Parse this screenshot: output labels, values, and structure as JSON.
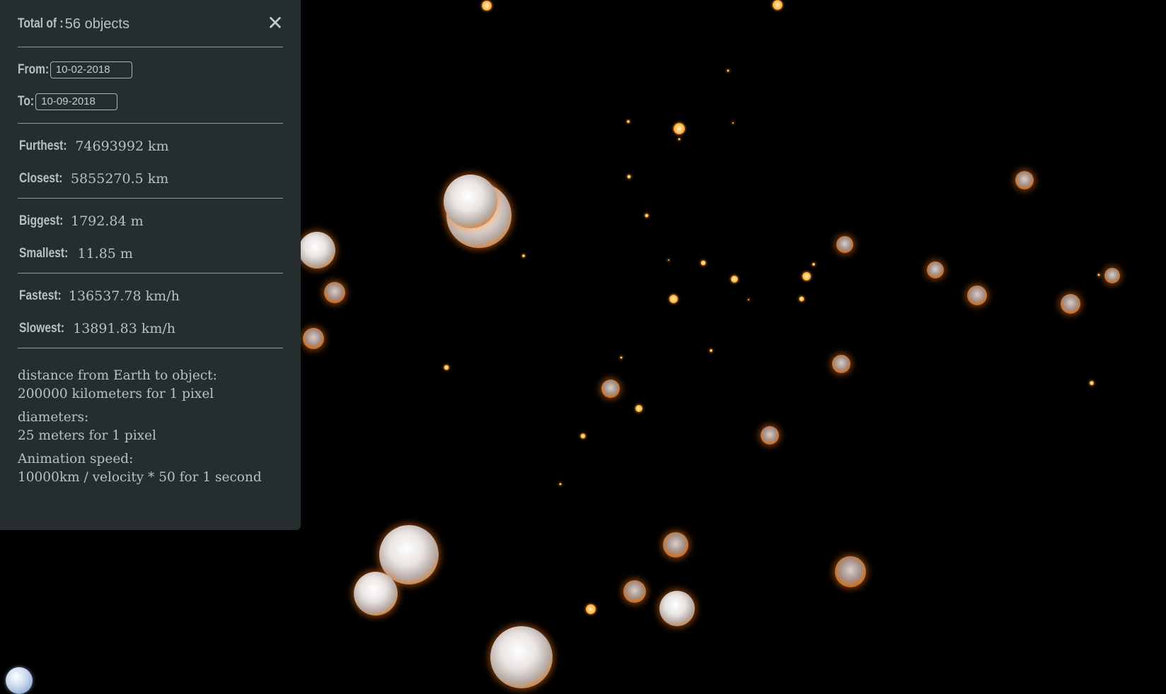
{
  "panel": {
    "total_label": "Total of :",
    "total_value": "56 objects",
    "close_icon": "close-icon",
    "from_label": "From:",
    "from_value": "10-02-2018",
    "to_label": "To:",
    "to_value": "10-09-2018",
    "furthest_label": "Furthest:",
    "furthest_value": "74693992 km",
    "closest_label": "Closest:",
    "closest_value": "5855270.5 km",
    "biggest_label": "Biggest:",
    "biggest_value": "1792.84 m",
    "smallest_label": "Smallest:",
    "smallest_value": "11.85 m",
    "fastest_label": "Fastest:",
    "fastest_value": "136537.78 km/h",
    "slowest_label": "Slowest:",
    "slowest_value": "13891.83 km/h",
    "notes": {
      "distance_title": "distance from Earth to object:",
      "distance_scale": "200000 kilometers for 1 pixel",
      "diameter_title": "diameters:",
      "diameter_scale": "25 meters for 1 pixel",
      "speed_title": "Animation speed:",
      "speed_scale": "10000km / velocity * 50 for 1 second"
    }
  },
  "colors": {
    "panel_bg": "#262d2f",
    "panel_text": "#b7c0c2",
    "scene_bg": "#000000",
    "asteroid_glow": "#ff8c1a"
  }
}
